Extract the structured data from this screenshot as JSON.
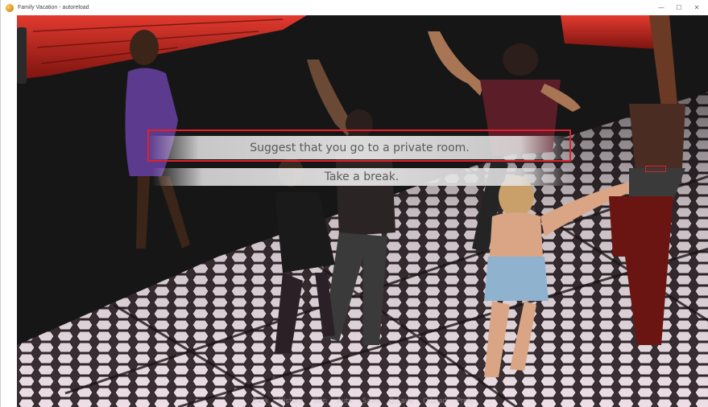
{
  "window": {
    "title": "Family Vacation - autoreload",
    "controls": {
      "minimize": "—",
      "maximize": "☐",
      "close": "✕"
    }
  },
  "choices": [
    {
      "label": "Suggest that you go to a private room."
    },
    {
      "label": "Take a break."
    }
  ],
  "quick_menu": [
    "Back",
    "History",
    "Skip",
    "Auto",
    "Save",
    "Q.Save",
    "Q.Load",
    "Prefs"
  ],
  "colors": {
    "highlight": "#e0202a",
    "choice_text": "#5a5a5a",
    "floor_light": "#e9dde4",
    "wall": "#1b1b1b",
    "neon_red": "#c6261e"
  }
}
